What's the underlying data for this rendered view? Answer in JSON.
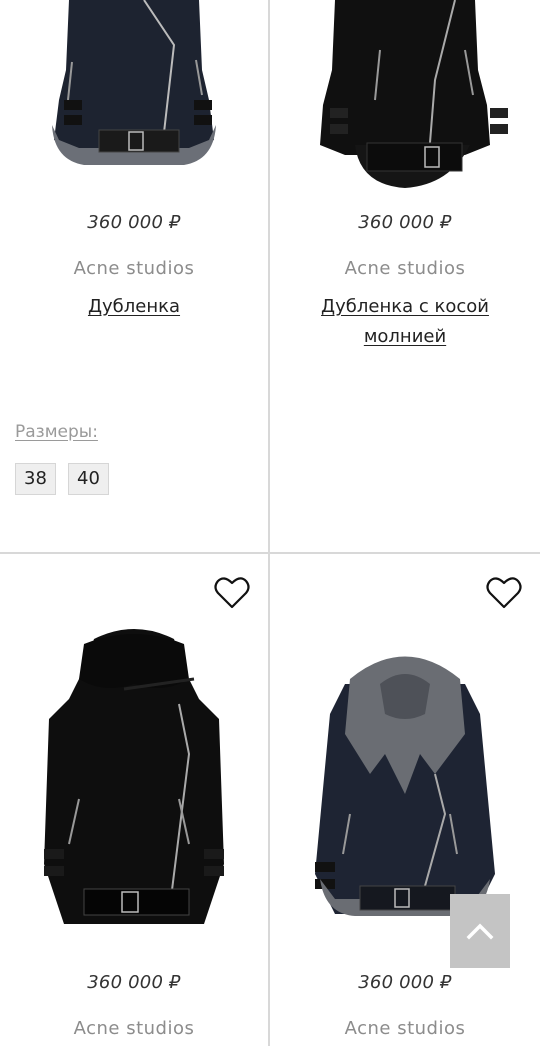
{
  "products": [
    {
      "price": "360 000 ₽",
      "brand": "Acne studios",
      "name": "Дубленка",
      "sizes_label": "Размеры:",
      "sizes": [
        "38",
        "40"
      ],
      "jacket_color": "#1d2330",
      "fur_color": "#6b6f77"
    },
    {
      "price": "360 000 ₽",
      "brand": "Acne studios",
      "name": "Дубленка с косой молнией",
      "jacket_color": "#101010",
      "fur_color": "#151515"
    },
    {
      "price": "360 000 ₽",
      "brand": "Acne studios",
      "favorite_icon": "heart-outline-icon",
      "jacket_color": "#0e0e0e",
      "fur_color": "#0a0a0a"
    },
    {
      "price": "360 000 ₽",
      "brand": "Acne studios",
      "favorite_icon": "heart-outline-icon",
      "jacket_color": "#1e2433",
      "fur_color": "#6a6d73"
    }
  ],
  "scroll_top": {
    "icon": "chevron-up-icon",
    "bg_color": "#c4c4c4"
  }
}
